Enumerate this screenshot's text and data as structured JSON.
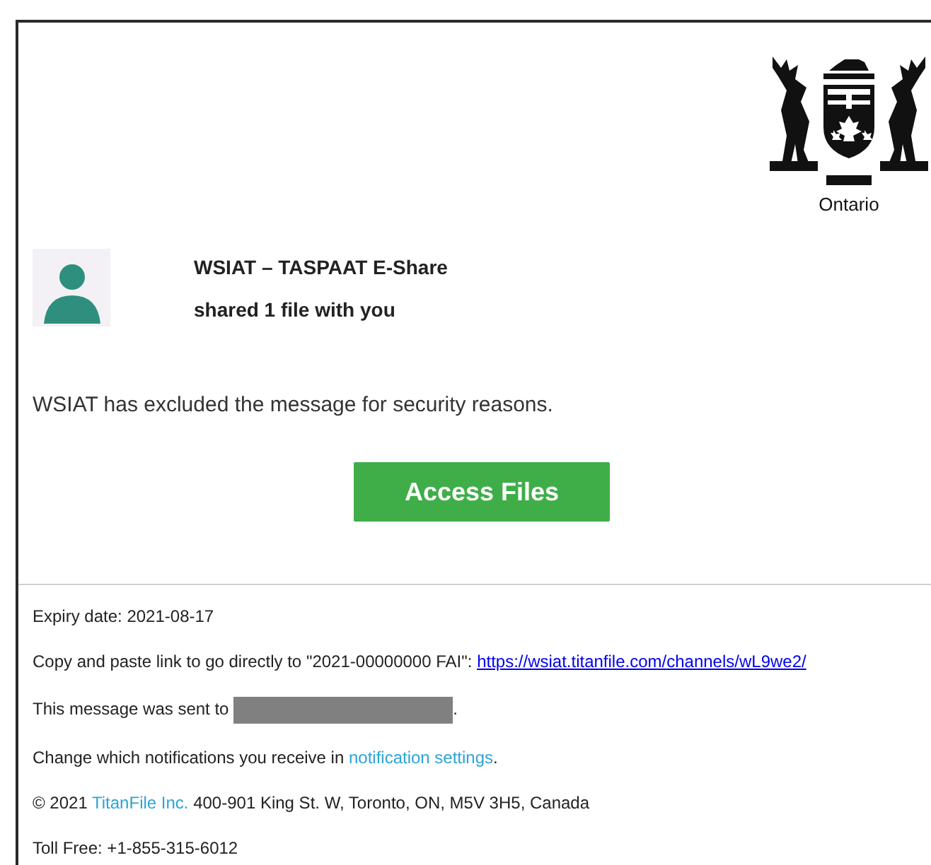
{
  "logo": {
    "caption": "Ontario"
  },
  "sender": {
    "name": "WSIAT – TASPAAT E-Share",
    "action": "shared 1 file with you"
  },
  "message": "WSIAT has excluded the message for security reasons.",
  "primary_button": {
    "label": "Access Files"
  },
  "footer": [
    {
      "kind": "text",
      "before": "Expiry date: 2021-08-17"
    },
    {
      "kind": "url",
      "before": "Copy and paste link to go directly to \"2021-00000000 FAI\": ",
      "link": "https://wsiat.titanfile.com/channels/wL9we2/"
    },
    {
      "kind": "redacted",
      "before": "This message was sent to ",
      "after": "."
    },
    {
      "kind": "inline_link",
      "before": "Change which notifications you receive in ",
      "link": "notification settings",
      "after": "."
    },
    {
      "kind": "inline_link",
      "before": "© 2021 ",
      "link": "TitanFile Inc.",
      "after": " 400-901 King St. W, Toronto, ON, M5V 3H5, Canada"
    },
    {
      "kind": "text",
      "before": "Toll Free: +1-855-315-6012"
    }
  ]
}
